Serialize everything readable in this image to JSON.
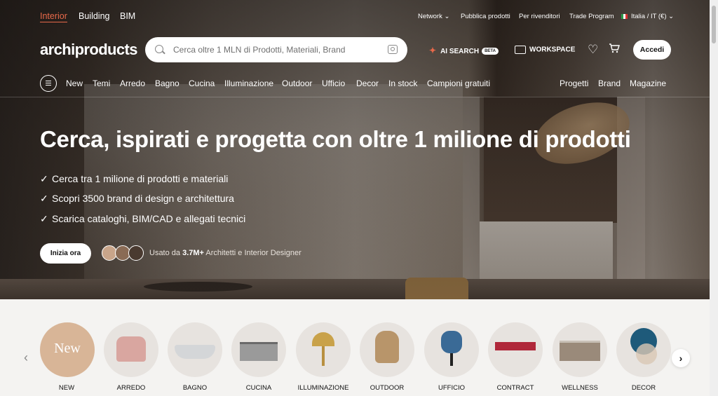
{
  "top_nav": {
    "tabs": [
      "Interior",
      "Building",
      "BIM"
    ],
    "active_tab": "Interior"
  },
  "utility_links": {
    "network": "Network",
    "pubblica": "Pubblica prodotti",
    "rivenditori": "Per rivenditori",
    "trade": "Trade Program",
    "locale": "Italia / IT (€)"
  },
  "header": {
    "logo": "archiproducts",
    "search_placeholder": "Cerca oltre 1 MLN di Prodotti, Materiali, Brand",
    "ai_search": "AI SEARCH",
    "beta": "BETA",
    "workspace": "WORKSPACE",
    "login": "Accedi"
  },
  "main_nav": {
    "items": [
      "New",
      "Temi",
      "Arredo",
      "Bagno",
      "Cucina",
      "Illuminazione",
      "Outdoor",
      "Ufficio",
      "Decor",
      "In stock",
      "Campioni gratuiti"
    ],
    "right_items": [
      "Progetti",
      "Brand",
      "Magazine"
    ]
  },
  "hero": {
    "title": "Cerca, ispirati e progetta con oltre 1 milione di prodotti",
    "bullets": [
      "Cerca tra 1 milione di prodotti e materiali",
      "Scopri 3500 brand di design e architettura",
      "Scarica cataloghi, BIM/CAD e allegati tecnici"
    ],
    "cta": "Inizia ora",
    "social_proof_prefix": "Usato da ",
    "social_proof_count": "3.7M+",
    "social_proof_suffix": " Architetti e Interior Designer"
  },
  "categories": {
    "new_badge": "New",
    "items": [
      "NEW",
      "ARREDO",
      "BAGNO",
      "CUCINA",
      "ILLUMINAZIONE",
      "OUTDOOR",
      "UFFICIO",
      "CONTRACT",
      "WELLNESS",
      "DECOR"
    ]
  },
  "colors": {
    "accent": "#e8694a",
    "new_bg": "#d8b597"
  }
}
